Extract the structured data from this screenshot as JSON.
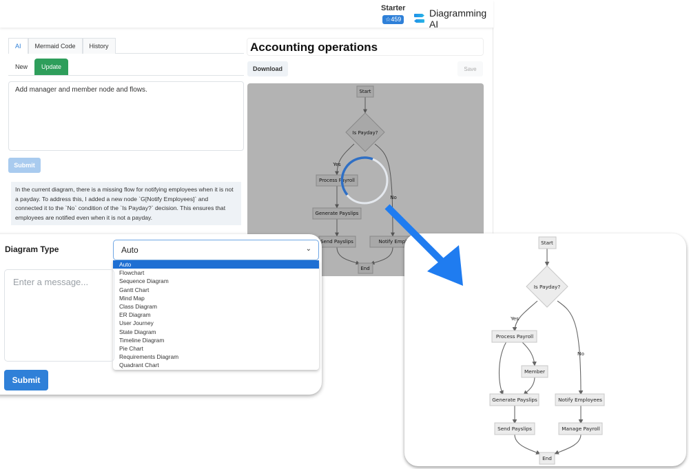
{
  "header": {
    "plan_name": "Starter",
    "star_count": "☆459",
    "brand_name": "Diagramming AI",
    "brand_color": "#2f80d8"
  },
  "left_panel": {
    "tabs": [
      {
        "label": "AI",
        "active": true
      },
      {
        "label": "Mermaid Code",
        "active": false
      },
      {
        "label": "History",
        "active": false
      }
    ],
    "subtabs": [
      {
        "label": "New",
        "active": false
      },
      {
        "label": "Update",
        "active": true
      }
    ],
    "prompt_value": "Add manager and member node and flows.",
    "submit_label": "Submit",
    "ai_response": "In the current diagram, there is a missing flow for notifying employees when it is not a payday. To address this, I added a new node `G[Notify Employees]` and connected it to the `No` condition of the `Is Payday?` decision. This ensures that employees are notified even when it is not a payday."
  },
  "right_panel": {
    "diagram_title": "Accounting operations",
    "download_label": "Download",
    "save_label": "Save",
    "loading": true
  },
  "diagram_type_panel": {
    "label": "Diagram Type",
    "selected": "Auto",
    "chevron_icon": "chevron-down-icon",
    "options": [
      "Auto",
      "Flowchart",
      "Sequence Diagram",
      "Gantt Chart",
      "Mind Map",
      "Class Diagram",
      "ER Diagram",
      "User Journey",
      "State Diagram",
      "Timeline Diagram",
      "Pie Chart",
      "Requirements Diagram",
      "Quadrant Chart"
    ],
    "message_placeholder": "Enter a message...",
    "submit_label": "Submit"
  },
  "preview_diagram": {
    "nodes": {
      "start": "Start",
      "decision": "Is Payday?",
      "process": "Process Payroll",
      "generate": "Generate Payslips",
      "send": "Send Payslips",
      "notify": "Notify Employ",
      "end": "End"
    },
    "edge_labels": {
      "yes": "Yes",
      "no": "No"
    }
  },
  "updated_diagram": {
    "nodes": {
      "start": "Start",
      "decision": "Is Payday?",
      "process": "Process Payroll",
      "member": "Member",
      "generate": "Generate Payslips",
      "notify": "Notify Employees",
      "send": "Send Payslips",
      "manage": "Manage Payroll",
      "end": "End"
    },
    "edge_labels": {
      "yes": "Yes",
      "no": "No"
    }
  }
}
